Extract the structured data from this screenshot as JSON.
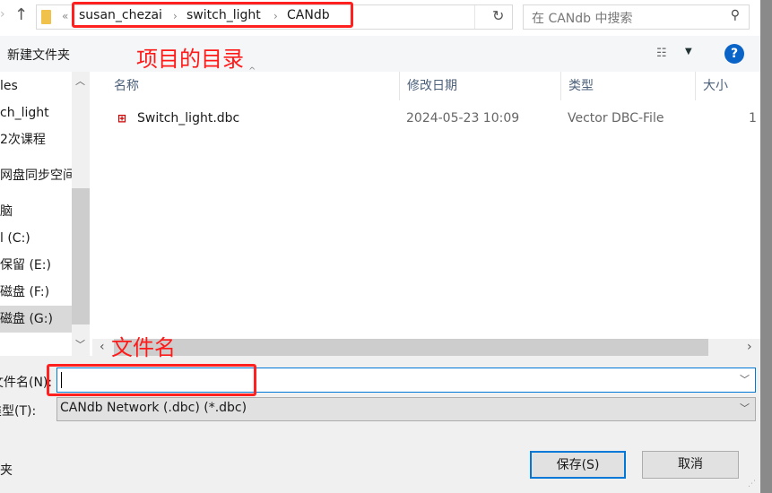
{
  "address": {
    "overflow": "«",
    "crumbs": [
      "susan_chezai",
      "switch_light",
      "CANdb"
    ],
    "separator": "›"
  },
  "search": {
    "placeholder": "在 CANdb 中搜索"
  },
  "toolbar": {
    "new_folder": "新建文件夹",
    "help": "?"
  },
  "nav": {
    "items": [
      "les",
      "ch_light",
      "2次课程",
      "网盘同步空间",
      "脑",
      "l (C:)",
      "保留 (E:)",
      "磁盘 (F:)",
      "磁盘 (G:)"
    ],
    "selected": "磁盘 (G:)"
  },
  "columns": {
    "name": "名称",
    "date": "修改日期",
    "type": "类型",
    "size": "大小"
  },
  "files": [
    {
      "name": "Switch_light.dbc",
      "date": "2024-05-23 10:09",
      "type": "Vector DBC-File",
      "size": "1"
    }
  ],
  "form": {
    "filename_label": "文件名(N):",
    "filename_value": "",
    "filetype_label": "类型(T):",
    "filetype_value": "CANdb Network (.dbc) (*.dbc)",
    "hide_folders": "夹"
  },
  "buttons": {
    "save": "保存(S)",
    "cancel": "取消"
  },
  "annotations": {
    "directory": "项目的目录",
    "filename": "文件名"
  },
  "colors": {
    "annotation": "#ff2020",
    "accent": "#0078d7",
    "help": "#0a64c8"
  }
}
